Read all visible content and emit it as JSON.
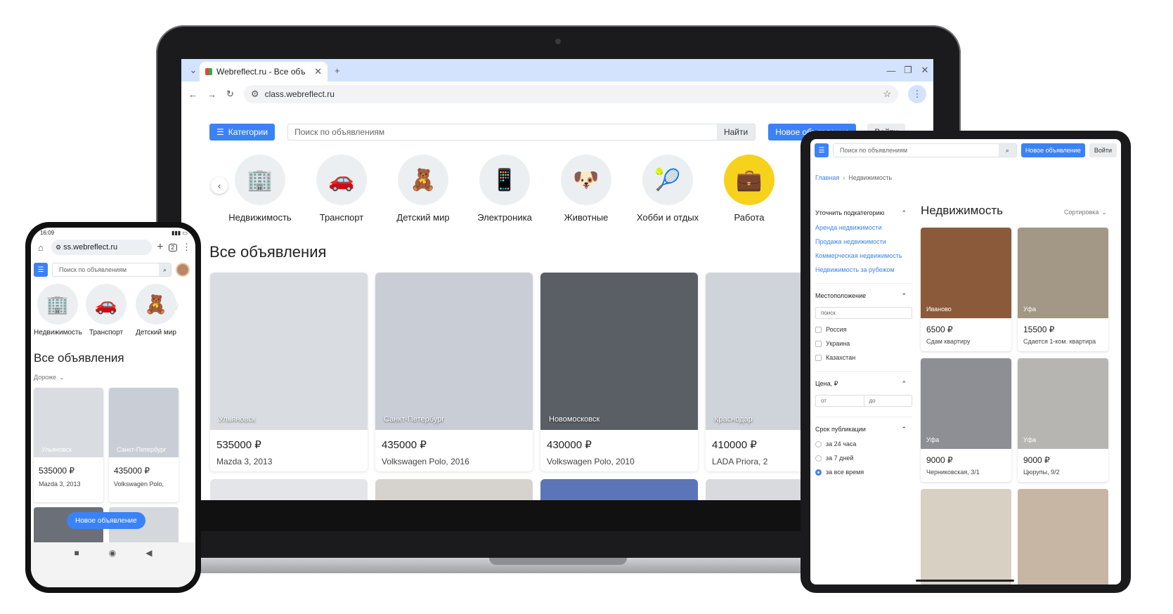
{
  "browser": {
    "tab_title": "Webreflect.ru - Все объ",
    "url": "class.webreflect.ru"
  },
  "header": {
    "categories_label": "Категории",
    "search_placeholder": "Поиск по объявлениям",
    "search_button": "Найти",
    "new_ad_button": "Новое объявление",
    "login_button": "Войти"
  },
  "categories": [
    {
      "label": "Недвижимость",
      "icon": "building-icon"
    },
    {
      "label": "Транспорт",
      "icon": "car-icon"
    },
    {
      "label": "Детский мир",
      "icon": "toys-icon"
    },
    {
      "label": "Электроника",
      "icon": "devices-icon"
    },
    {
      "label": "Животные",
      "icon": "pets-icon"
    },
    {
      "label": "Хобби и отдых",
      "icon": "sports-icon"
    },
    {
      "label": "Работа",
      "icon": "briefcase-icon"
    }
  ],
  "main": {
    "heading": "Все объявления",
    "listings": [
      {
        "location": "Ульяновск",
        "price": "535000 ₽",
        "title": "Mazda 3, 2013",
        "color": "#d9dde2"
      },
      {
        "location": "Санкт-Петербург",
        "price": "435000 ₽",
        "title": "Volkswagen Polo, 2016",
        "color": "#c9ced6"
      },
      {
        "location": "Новомосковск",
        "price": "430000 ₽",
        "title": "Volkswagen Polo, 2010",
        "color": "#5a5f66"
      },
      {
        "location": "Краснодар",
        "price": "410000 ₽",
        "title": "LADA Priora, 2",
        "color": "#cfd4da"
      }
    ]
  },
  "tablet": {
    "search_placeholder": "Поиск по объявлениям",
    "new_ad_button": "Новое объявление",
    "login_button": "Войти",
    "breadcrumb_home": "Главная",
    "breadcrumb_sep": "›",
    "breadcrumb_current": "Недвижимость",
    "heading": "Недвижимость",
    "sort_label": "Сортировка",
    "filter_subcat_title": "Уточнить подкатегорию",
    "subcategories": [
      "Аренда недвижимости",
      "Продажа недвижимости",
      "Коммерческая недвижимость",
      "Недвижимость за рубежом"
    ],
    "filter_location_title": "Местоположение",
    "location_search_placeholder": "поиск",
    "countries": [
      "Россия",
      "Украина",
      "Казахстан"
    ],
    "filter_price_title": "Цена, ₽",
    "price_from_placeholder": "от",
    "price_to_placeholder": "до",
    "filter_date_title": "Срок публикации",
    "date_options": [
      "за 24 часа",
      "за 7 дней",
      "за все время"
    ],
    "listings": [
      {
        "location": "Иваново",
        "price": "6500 ₽",
        "title": "Сдам квартиру",
        "color": "#8a5a3a"
      },
      {
        "location": "Уфа",
        "price": "15500 ₽",
        "title": "Сдается 1-ком. квартира",
        "color": "#a39785"
      },
      {
        "location": "Уфа",
        "price": "9000 ₽",
        "title": "Черниковская, 3/1",
        "color": "#8d8f95"
      },
      {
        "location": "Уфа",
        "price": "9000 ₽",
        "title": "Цюрупы, 9/2",
        "color": "#b7b5b2"
      }
    ]
  },
  "phone": {
    "time": "16:09",
    "url": "ss.webreflect.ru",
    "tab_count": "2",
    "search_placeholder": "Поиск по объявлениям",
    "categories": [
      "Недвижимость",
      "Транспорт",
      "Детский мир"
    ],
    "heading": "Все объявления",
    "sort_label": "Дороже",
    "new_ad_button": "Новое объявление",
    "listings": [
      {
        "location": "Ульяновск",
        "price": "535000 ₽",
        "title": "Mazda 3, 2013",
        "color": "#d9dde2"
      },
      {
        "location": "Санкт-Петербург",
        "price": "435000 ₽",
        "title": "Volkswagen Polo,",
        "color": "#c9ced6"
      }
    ]
  }
}
